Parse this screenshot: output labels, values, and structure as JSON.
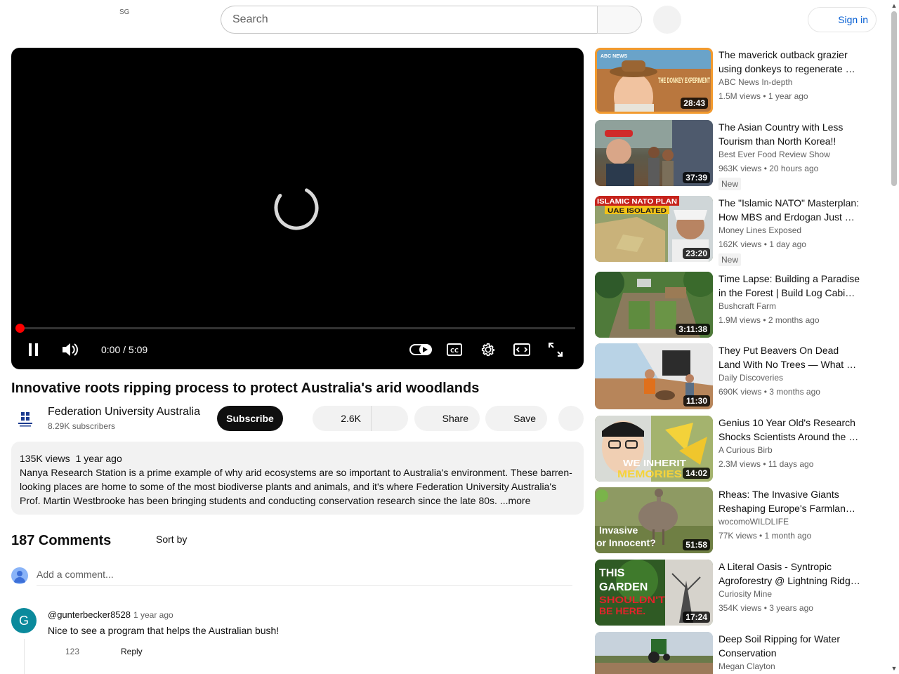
{
  "header": {
    "country_code": "SG",
    "search_placeholder": "Search",
    "signin_label": "Sign in"
  },
  "player": {
    "time": "0:00 / 5:09",
    "progress": 0
  },
  "video": {
    "title": "Innovative roots ripping process to protect Australia's arid woodlands",
    "channel_name": "Federation University Australia",
    "subscribers": "8.29K subscribers",
    "subscribe_label": "Subscribe",
    "likes": "2.6K",
    "share_label": "Share",
    "save_label": "Save",
    "views": "135K views",
    "age": "1 year ago",
    "description": "Nanya Research Station is a prime example of why arid ecosystems are so important to Australia's environment. These barren-looking places are home to some of the most biodiverse plants and animals, and it's where Federation University Australia's Prof. Martin Westbrooke has been bringing students and conducting conservation research since the late 80s.",
    "more_label": "...more"
  },
  "comments": {
    "count": "187 Comments",
    "sort_label": "Sort by",
    "add_placeholder": "Add a comment...",
    "items": [
      {
        "avatar_letter": "G",
        "author": "@gunterbecker8528",
        "time": "1 year ago",
        "text": "Nice to see a program that helps the Australian bush!",
        "likes": "123",
        "reply_label": "Reply"
      }
    ]
  },
  "recommendations": [
    {
      "title": "The maverick outback grazier using donkeys to regenerate …",
      "channel": "ABC News In-depth",
      "meta": "1.5M views • 1 year ago",
      "duration": "28:43",
      "badge": ""
    },
    {
      "title": "The Asian Country with Less Tourism than North Korea!!",
      "channel": "Best Ever Food Review Show",
      "meta": "963K views • 20 hours ago",
      "duration": "37:39",
      "badge": "New"
    },
    {
      "title": "The \"Islamic NATO\" Masterplan: How MBS and Erdogan Just …",
      "channel": "Money Lines Exposed",
      "meta": "162K views • 1 day ago",
      "duration": "23:20",
      "badge": "New"
    },
    {
      "title": "Time Lapse: Building a Paradise in the Forest | Build Log Cabi…",
      "channel": "Bushcraft Farm",
      "meta": "1.9M views • 2 months ago",
      "duration": "3:11:38",
      "badge": ""
    },
    {
      "title": "They Put Beavers On Dead Land With No Trees — What …",
      "channel": "Daily Discoveries",
      "meta": "690K views • 3 months ago",
      "duration": "11:30",
      "badge": ""
    },
    {
      "title": "Genius 10 Year Old's Research Shocks Scientists Around the …",
      "channel": "A Curious Birb",
      "meta": "2.3M views • 11 days ago",
      "duration": "14:02",
      "badge": ""
    },
    {
      "title": "Rheas: The Invasive Giants Reshaping Europe's Farmlan…",
      "channel": "wocomoWILDLIFE",
      "meta": "77K views • 1 month ago",
      "duration": "51:58",
      "badge": ""
    },
    {
      "title": "A Literal Oasis - Syntropic Agroforestry @ Lightning Ridg…",
      "channel": "Curiosity Mine",
      "meta": "354K views • 3 years ago",
      "duration": "17:24",
      "badge": ""
    },
    {
      "title": "Deep Soil Ripping for Water Conservation",
      "channel": "Megan Clayton",
      "meta": "",
      "duration": "",
      "badge": ""
    }
  ],
  "thumbnail_text": {
    "t0": [
      "ABC NEWS",
      "THE DONKEY EXPERIMENT"
    ],
    "t2": [
      "ISLAMIC NATO PLAN",
      "UAE ISOLATED"
    ],
    "t5": [
      "WE INHERIT",
      "MEMORIES"
    ],
    "t6": [
      "Invasive",
      "or Innocent?"
    ],
    "t7": [
      "THIS",
      "GARDEN",
      "SHOULDN'T",
      "BE HERE."
    ]
  },
  "colors": {
    "accent_red": "#ff0000",
    "link_blue": "#065fd4",
    "chip_bg": "#f2f2f2"
  }
}
